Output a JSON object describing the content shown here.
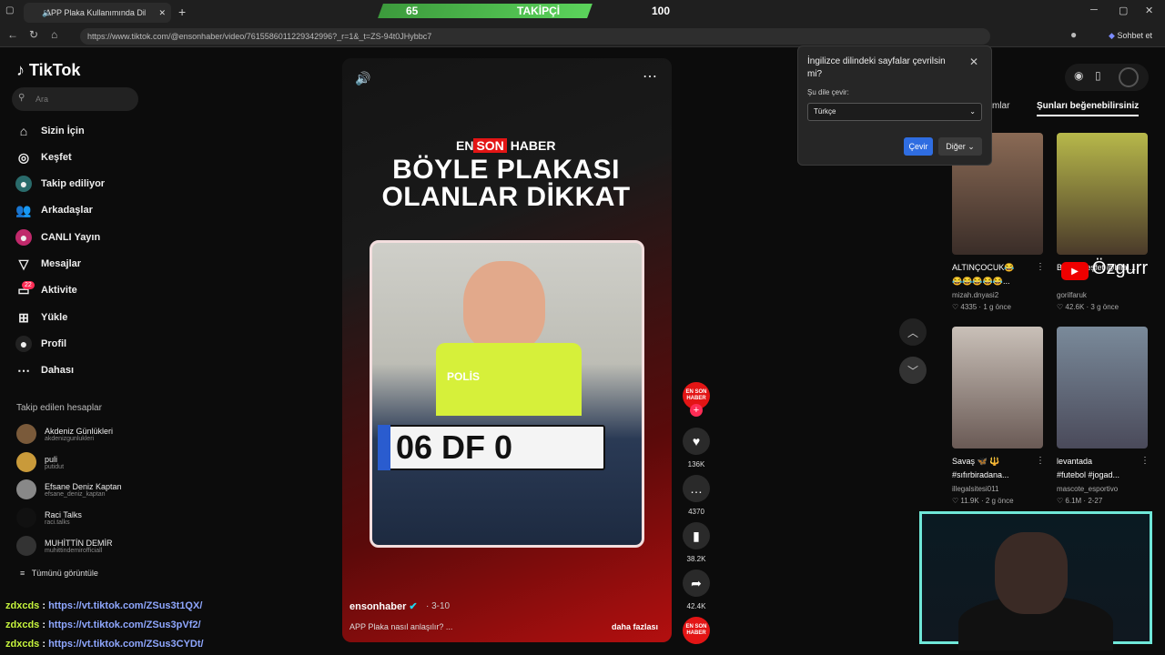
{
  "browser": {
    "tab_title": "APP Plaka Kullanımında Dikk...",
    "url": "https://www.tiktok.com/@ensonhaber/video/7615586011229342996?_r=1&_t=ZS-94t0JHybbc7",
    "copilot_label": "Sohbet et"
  },
  "stream_overlay": {
    "count_left": "65",
    "label": "TAKİPÇİ",
    "count_right": "100"
  },
  "sidebar": {
    "logo": "TikTok",
    "search_placeholder": "Ara",
    "nav": [
      {
        "label": "Sizin İçin"
      },
      {
        "label": "Keşfet"
      },
      {
        "label": "Takip ediliyor"
      },
      {
        "label": "Arkadaşlar"
      },
      {
        "label": "CANLI Yayın"
      },
      {
        "label": "Mesajlar"
      },
      {
        "label": "Aktivite"
      },
      {
        "label": "Yükle"
      },
      {
        "label": "Profil"
      },
      {
        "label": "Dahası"
      }
    ],
    "activity_badge": "22",
    "following_title": "Takip edilen hesaplar",
    "accounts": [
      {
        "name": "Akdeniz Günlükleri",
        "handle": "akdenizgunlukleri"
      },
      {
        "name": "puli",
        "handle": "putidut"
      },
      {
        "name": "Efsane Deniz Kaptan",
        "handle": "efsane_deniz_kaptan"
      },
      {
        "name": "Raci Talks",
        "handle": "raci.talks"
      },
      {
        "name": "MUHİTTİN DEMİR",
        "handle": "muhittindemirofficiall"
      }
    ],
    "see_all": "Tümünü görüntüle"
  },
  "chat": [
    {
      "user": "zdxcds",
      "link": "https://vt.tiktok.com/ZSus3t1QX/"
    },
    {
      "user": "zdxcds",
      "link": "https://vt.tiktok.com/ZSus3pVf2/"
    },
    {
      "user": "zdxcds",
      "link": "https://vt.tiktok.com/ZSus3CYDt/"
    }
  ],
  "video": {
    "brand_en": "EN",
    "brand_son": "SON",
    "brand_haber": "HABER",
    "headline_1": "BÖYLE PLAKASI",
    "headline_2": "OLANLAR DİKKAT",
    "plate_text": "06 DF 0",
    "vest_text": "POLİS",
    "author": "ensonhaber",
    "date": "· 3-10",
    "description": "APP Plaka nasıl anlaşılır? ...",
    "more": "daha fazlası"
  },
  "actions": {
    "likes": "136K",
    "comments": "4370",
    "saves": "38.2K",
    "shares": "42.4K",
    "avatar_text": "EN SON HABER"
  },
  "right": {
    "tab1": "mlar",
    "tab2": "Şunları beğenebilirsiniz",
    "cards": [
      {
        "title": "ALTINÇOCUK😂",
        "sub": "😂😂😂😂😂...",
        "user": "mizah.dnyasi2",
        "likes": "4335",
        "age": "1 g önce"
      },
      {
        "title": "B... ve keşfet @bilal...",
        "sub": "",
        "user": "gorilfaruk",
        "likes": "42.6K",
        "age": "3 g önce"
      },
      {
        "title": "Savaş 🦋 🔱",
        "sub": "#sıfırbiradana...",
        "user": "illegalsitesi011",
        "likes": "11.9K",
        "age": "2 g önce"
      },
      {
        "title": "levantada",
        "sub": "#futebol #jogad...",
        "user": "mascote_esportivo",
        "likes": "6.1M",
        "age": "2-27"
      }
    ],
    "yt_name": "Özgurr"
  },
  "translate": {
    "title": "İngilizce dilindeki sayfalar çevrilsin mi?",
    "label": "Şu dile çevir:",
    "selected": "Türkçe",
    "translate_btn": "Çevir",
    "other_btn": "Diğer"
  }
}
